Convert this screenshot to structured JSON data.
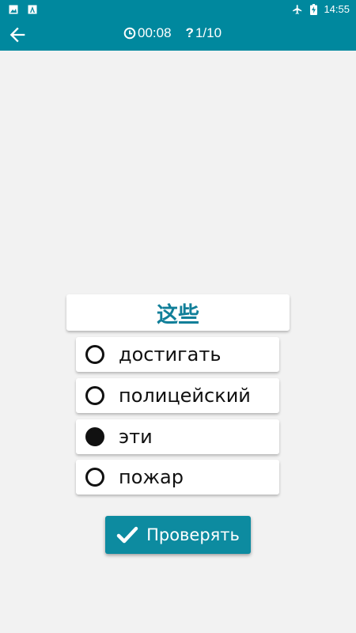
{
  "status_bar": {
    "time": "14:55",
    "left_icons": [
      "image-icon",
      "app-notification-icon"
    ],
    "right_icons": [
      "airplane-icon",
      "battery-charging-icon"
    ]
  },
  "app_bar": {
    "back_icon": "arrow-left-icon",
    "timer_icon": "clock-icon",
    "timer": "00:08",
    "question_icon": "question-icon",
    "progress": "1/10"
  },
  "quiz": {
    "word": "这些",
    "options": [
      {
        "label": "достигать",
        "selected": false
      },
      {
        "label": "полицейский",
        "selected": false
      },
      {
        "label": "эти",
        "selected": true
      },
      {
        "label": "пожар",
        "selected": false
      }
    ]
  },
  "check_button": {
    "label": "Проверять",
    "icon": "checkmark-icon"
  },
  "colors": {
    "primary": "#00889e",
    "word": "#117f99",
    "background": "#f2f2f2"
  }
}
